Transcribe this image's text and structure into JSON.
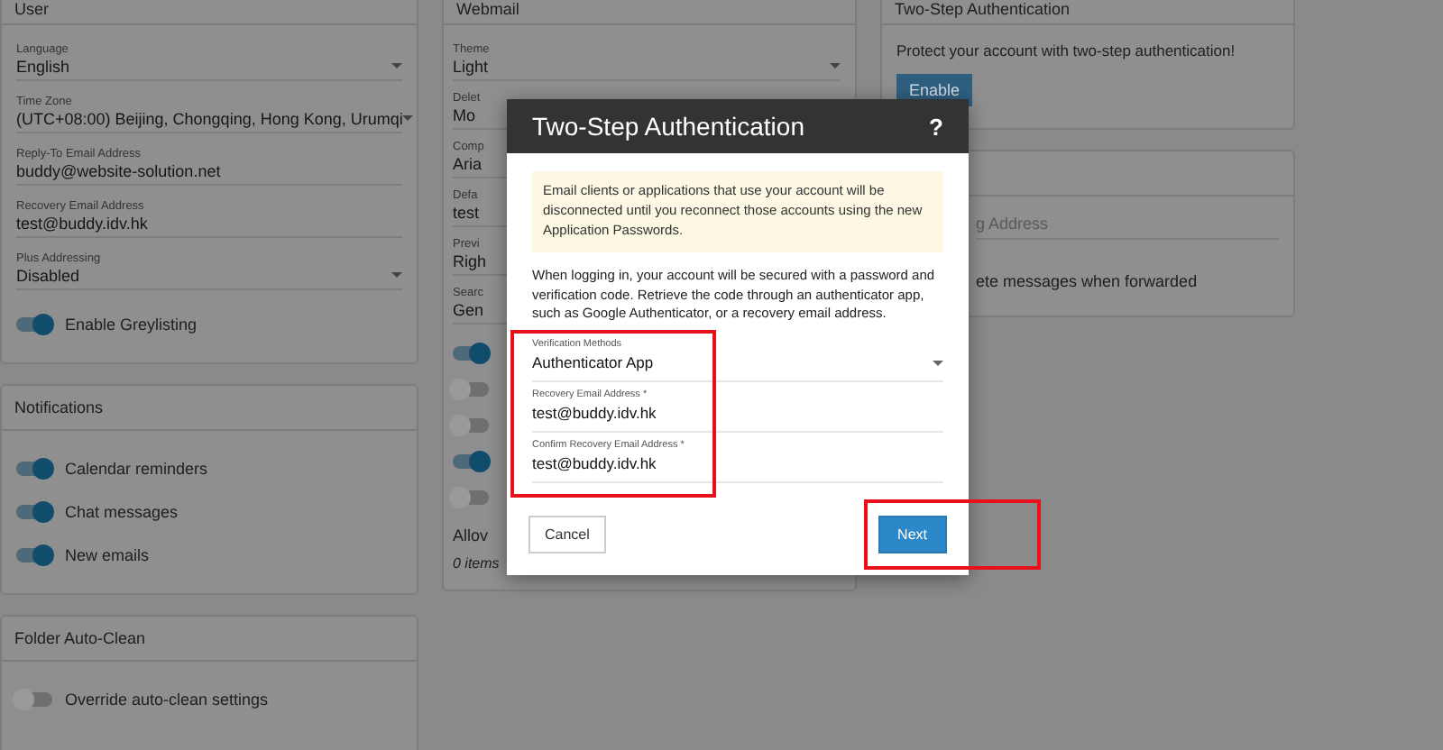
{
  "user_panel": {
    "title": "User",
    "fields": [
      {
        "kind": "select",
        "label": "Language",
        "value": "English"
      },
      {
        "kind": "select",
        "label": "Time Zone",
        "value": "(UTC+08:00) Beijing, Chongqing, Hong Kong, Urumqi"
      },
      {
        "kind": "text",
        "label": "Reply-To Email Address",
        "value": "buddy@website-solution.net"
      },
      {
        "kind": "text",
        "label": "Recovery Email Address",
        "value": "test@buddy.idv.hk"
      },
      {
        "kind": "select",
        "label": "Plus Addressing",
        "value": "Disabled"
      }
    ],
    "toggles": [
      {
        "label": "Enable Greylisting",
        "on": true
      }
    ]
  },
  "notifications": {
    "title": "Notifications",
    "toggles": [
      {
        "label": "Calendar reminders",
        "on": true
      },
      {
        "label": "Chat messages",
        "on": true
      },
      {
        "label": "New emails",
        "on": true
      }
    ]
  },
  "folder_auto_clean": {
    "title": "Folder Auto-Clean",
    "toggles": [
      {
        "label": "Override auto-clean settings",
        "on": false
      }
    ]
  },
  "webmail": {
    "title": "Webmail",
    "fields": [
      {
        "kind": "select",
        "label": "Theme",
        "value": "Light"
      },
      {
        "kind": "text",
        "label": "Delet",
        "value": "Mo"
      },
      {
        "kind": "text",
        "label": "Comp",
        "value": "Aria"
      },
      {
        "kind": "text",
        "label": "Defa",
        "value": "test"
      },
      {
        "kind": "text",
        "label": "Previ",
        "value": "Righ"
      },
      {
        "kind": "text",
        "label": "Searc",
        "value": "Gen"
      }
    ],
    "toggles": [
      {
        "on": true
      },
      {
        "on": false
      },
      {
        "on": false
      },
      {
        "on": true
      },
      {
        "on": false
      }
    ],
    "list_label": "Allov",
    "count": "0 items"
  },
  "two_step_panel": {
    "title": "Two-Step Authentication",
    "text": "Protect your account with two-step authentication!",
    "button": "Enable"
  },
  "forwarding_panel": {
    "placeholder": "g Address",
    "toggle_label": "ete messages when forwarded"
  },
  "dialog": {
    "title": "Two-Step Authentication",
    "help": "?",
    "notice": "Email clients or applications that use your account will be disconnected until you reconnect those accounts using the new Application Passwords.",
    "description": "When logging in, your account will be secured with a password and verification code. Retrieve the code through an authenticator app, such as Google Authenticator, or a recovery email address.",
    "fields": [
      {
        "kind": "select",
        "label": "Verification Methods",
        "value": "Authenticator App"
      },
      {
        "kind": "text",
        "label": "Recovery Email Address *",
        "value": "test@buddy.idv.hk"
      },
      {
        "kind": "text",
        "label": "Confirm Recovery Email Address *",
        "value": "test@buddy.idv.hk"
      }
    ],
    "buttons": [
      {
        "label": "Cancel",
        "primary": false
      },
      {
        "label": "Next",
        "primary": true
      }
    ]
  }
}
